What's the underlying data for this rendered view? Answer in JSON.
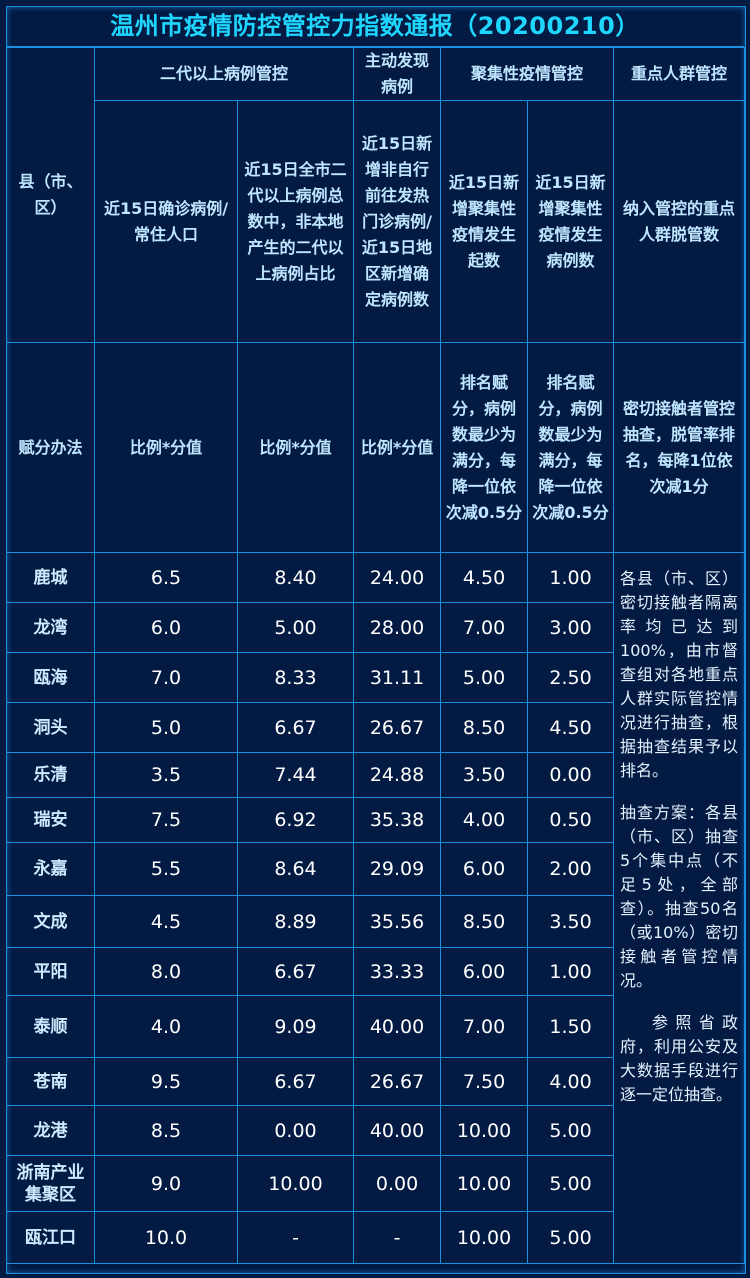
{
  "title": "温州市疫情防控管控力指数通报（20200210）",
  "header": {
    "county_label": "县（市、区）",
    "group1": "二代以上病例管控",
    "group2": "主动发现病例",
    "group3": "聚集性疫情管控",
    "group4": "重点人群管控",
    "col1": "近15日确诊病例/常住人口",
    "col2": "近15日全市二代以上病例总数中，非本地产生的二代以上病例占比",
    "col3": "近15日新增非自行前往发热门诊病例/近15日地区新增确定病例数",
    "col4": "近15日新增聚集性疫情发生起数",
    "col5": "近15日新增聚集性疫情发生病例数",
    "col6": "纳入管控的重点人群脱管数"
  },
  "scoring": {
    "label": "赋分办法",
    "col1": "比例*分值",
    "col2": "比例*分值",
    "col3": "比例*分值",
    "col4": "排名赋分，病例数最少为满分，每降一位依次减0.5分",
    "col5": "排名赋分，病例数最少为满分，每降一位依次减0.5分",
    "col6": "密切接触者管控抽查，脱管率排名，每降1位依次减1分"
  },
  "rows": [
    {
      "county": "鹿城",
      "c1": "6.5",
      "c2": "8.40",
      "c3": "24.00",
      "c4": "4.50",
      "c5": "1.00"
    },
    {
      "county": "龙湾",
      "c1": "6.0",
      "c2": "5.00",
      "c3": "28.00",
      "c4": "7.00",
      "c5": "3.00"
    },
    {
      "county": "瓯海",
      "c1": "7.0",
      "c2": "8.33",
      "c3": "31.11",
      "c4": "5.00",
      "c5": "2.50"
    },
    {
      "county": "洞头",
      "c1": "5.0",
      "c2": "6.67",
      "c3": "26.67",
      "c4": "8.50",
      "c5": "4.50"
    },
    {
      "county": "乐清",
      "c1": "3.5",
      "c2": "7.44",
      "c3": "24.88",
      "c4": "3.50",
      "c5": "0.00"
    },
    {
      "county": "瑞安",
      "c1": "7.5",
      "c2": "6.92",
      "c3": "35.38",
      "c4": "4.00",
      "c5": "0.50"
    },
    {
      "county": "永嘉",
      "c1": "5.5",
      "c2": "8.64",
      "c3": "29.09",
      "c4": "6.00",
      "c5": "2.00"
    },
    {
      "county": "文成",
      "c1": "4.5",
      "c2": "8.89",
      "c3": "35.56",
      "c4": "8.50",
      "c5": "3.50"
    },
    {
      "county": "平阳",
      "c1": "8.0",
      "c2": "6.67",
      "c3": "33.33",
      "c4": "6.00",
      "c5": "1.00"
    },
    {
      "county": "泰顺",
      "c1": "4.0",
      "c2": "9.09",
      "c3": "40.00",
      "c4": "7.00",
      "c5": "1.50"
    },
    {
      "county": "苍南",
      "c1": "9.5",
      "c2": "6.67",
      "c3": "26.67",
      "c4": "7.50",
      "c5": "4.00"
    },
    {
      "county": "龙港",
      "c1": "8.5",
      "c2": "0.00",
      "c3": "40.00",
      "c4": "10.00",
      "c5": "5.00"
    },
    {
      "county": "浙南产业集聚区",
      "c1": "9.0",
      "c2": "10.00",
      "c3": "0.00",
      "c4": "10.00",
      "c5": "5.00"
    },
    {
      "county": "瓯江口",
      "c1": "10.0",
      "c2": "-",
      "c3": "-",
      "c4": "10.00",
      "c5": "5.00"
    }
  ],
  "note": {
    "p1": "各县（市、区）密切接触者隔离率均已达到100%，由市督查组对各地重点人群实际管控情况进行抽查，根据抽查结果予以排名。",
    "p2": "抽查方案：各县（市、区）抽查5个集中点（不足5处，全部查）。抽查50名（或10%）密切接触者管控情况。",
    "p3": "参照省政府，利用公安及大数据手段进行逐一定位抽查。"
  }
}
